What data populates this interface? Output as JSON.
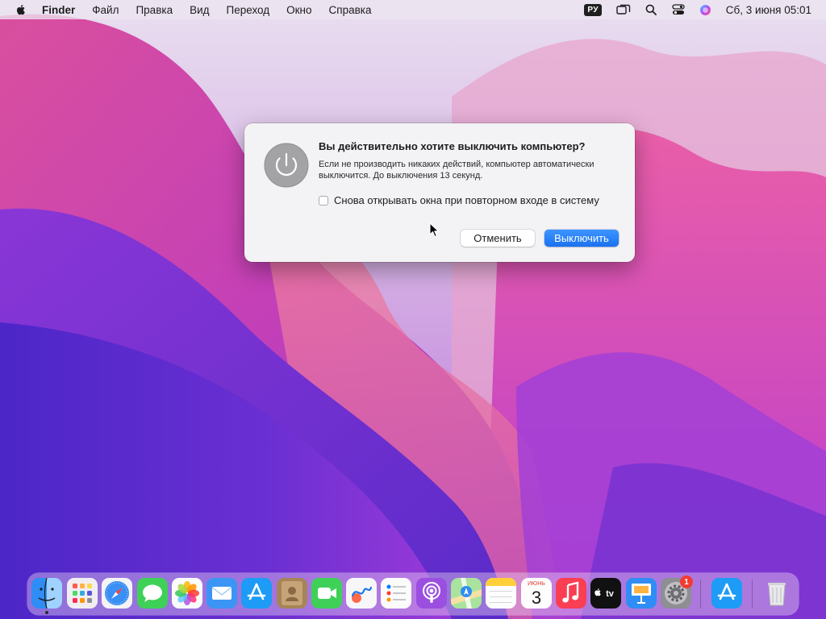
{
  "menubar": {
    "app_name": "Finder",
    "menus": [
      "Файл",
      "Правка",
      "Вид",
      "Переход",
      "Окно",
      "Справка"
    ],
    "keyboard_layout": "РУ",
    "status_icons": [
      "screen-mirroring-icon",
      "spotlight-search-icon",
      "control-center-icon",
      "siri-icon"
    ],
    "clock": "Сб, 3 июня  05:01"
  },
  "dialog": {
    "icon": "power-icon",
    "title": "Вы действительно хотите выключить компьютер?",
    "message": "Если не производить никаких действий, компьютер автоматически выключится. До выключения 13 секунд.",
    "checkbox_label": "Снова открывать окна при повторном входе в систему",
    "checkbox_checked": false,
    "cancel_label": "Отменить",
    "confirm_label": "Выключить",
    "accent_color": "#2a84f7"
  },
  "dock": {
    "apps": [
      {
        "name": "Finder",
        "icon": "finder-icon",
        "running": true
      },
      {
        "name": "Launchpad",
        "icon": "launchpad-icon"
      },
      {
        "name": "Safari",
        "icon": "safari-icon"
      },
      {
        "name": "Messages",
        "icon": "messages-icon"
      },
      {
        "name": "Photos",
        "icon": "photos-icon"
      },
      {
        "name": "Mail",
        "icon": "mail-icon"
      },
      {
        "name": "App Store",
        "icon": "app-store-icon"
      },
      {
        "name": "Contacts",
        "icon": "contacts-icon"
      },
      {
        "name": "FaceTime",
        "icon": "facetime-icon"
      },
      {
        "name": "Freeform",
        "icon": "freeform-icon"
      },
      {
        "name": "Reminders",
        "icon": "reminders-icon"
      },
      {
        "name": "Podcasts",
        "icon": "podcasts-icon"
      },
      {
        "name": "Maps",
        "icon": "maps-icon"
      },
      {
        "name": "Notes",
        "icon": "notes-icon"
      },
      {
        "name": "Calendar",
        "icon": "calendar-icon"
      },
      {
        "name": "Music",
        "icon": "music-icon"
      },
      {
        "name": "TV",
        "icon": "tv-icon"
      },
      {
        "name": "Keynote",
        "icon": "keynote-icon"
      },
      {
        "name": "System Settings",
        "icon": "system-settings-icon",
        "badge": "1"
      },
      {
        "name": "App Store",
        "icon": "app-store-icon"
      },
      {
        "name": "Trash",
        "icon": "trash-icon"
      }
    ],
    "calendar_month": "ИЮНЬ",
    "calendar_day": "3",
    "tv_label": "tv",
    "settings_badge": "1"
  }
}
